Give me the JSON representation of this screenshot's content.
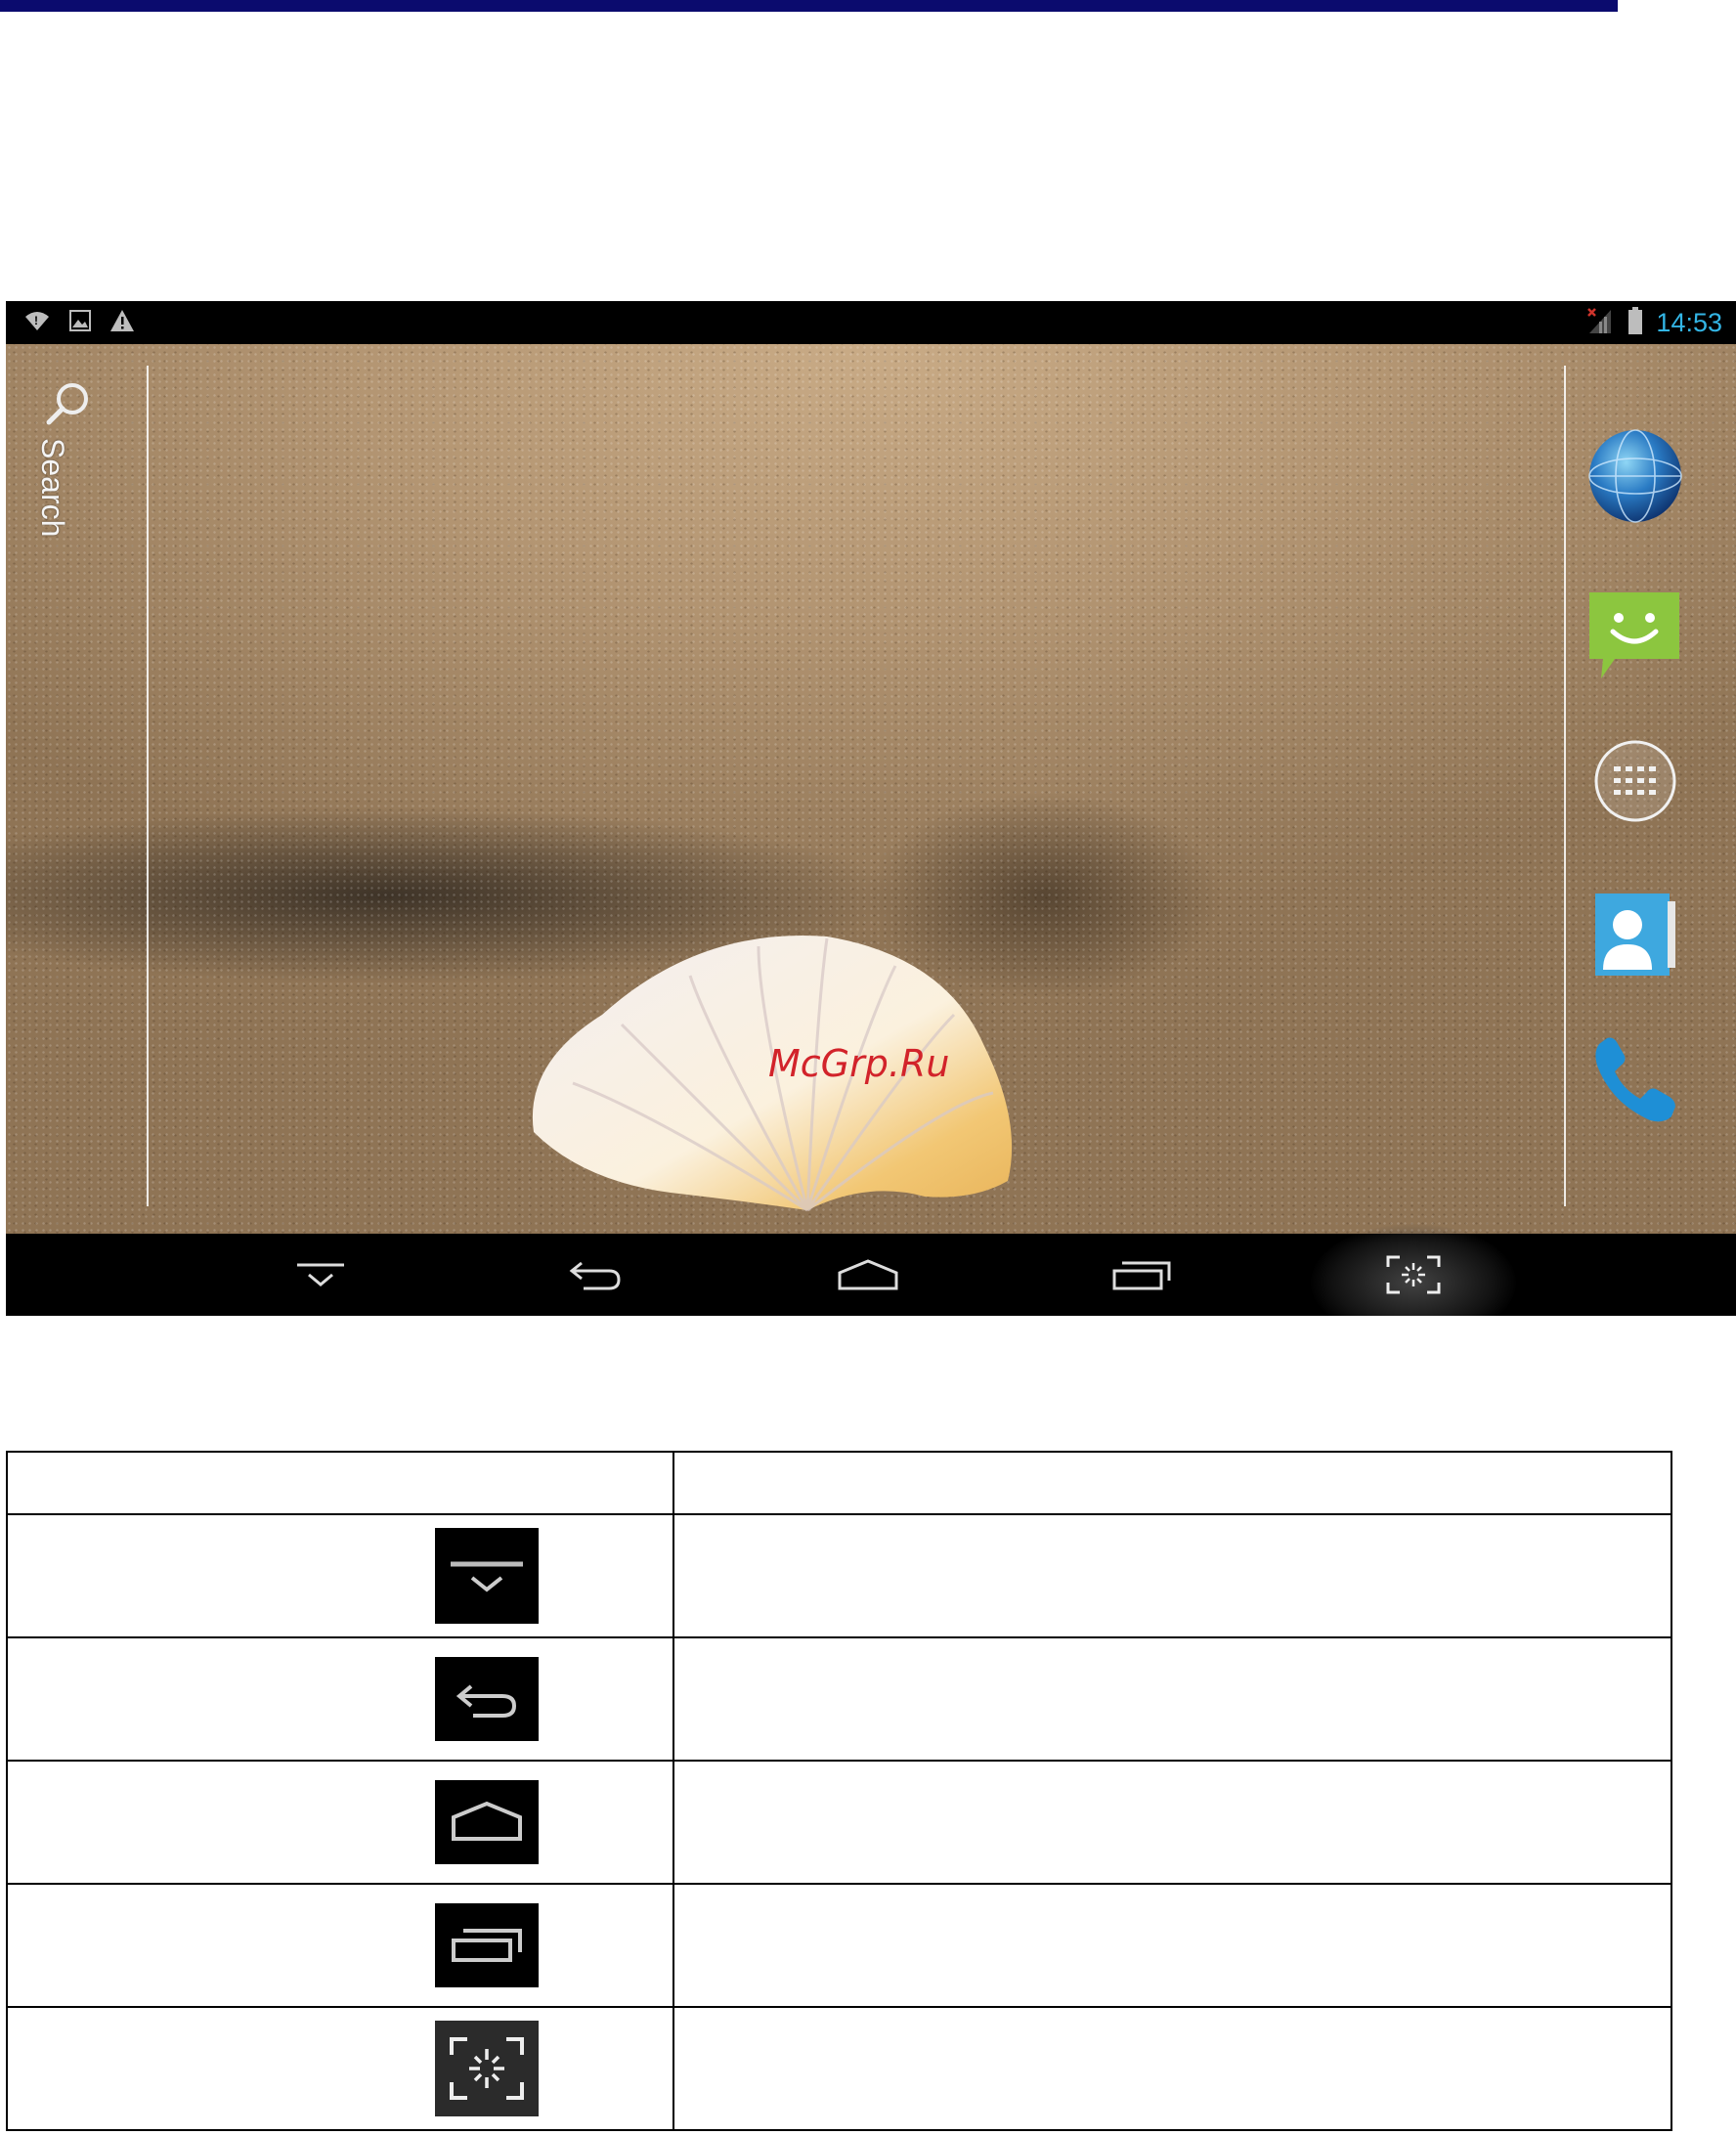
{
  "status_bar": {
    "left_icons": [
      "wifi-warning-icon",
      "image-notification-icon",
      "warning-icon"
    ],
    "right_icons": [
      "signal-icon",
      "battery-icon"
    ],
    "clock": "14:53"
  },
  "home": {
    "search_label": "Search",
    "dock_items": [
      "browser-globe-icon",
      "messaging-icon",
      "all-apps-icon",
      "contacts-icon",
      "phone-icon"
    ]
  },
  "watermark": "McGrp.Ru",
  "nav_bar": {
    "buttons": [
      "hide-bar-icon",
      "back-icon",
      "home-icon",
      "recent-apps-icon",
      "screenshot-icon"
    ]
  },
  "table": {
    "header": [
      "",
      ""
    ],
    "rows": [
      {
        "icon": "hide-bar-icon",
        "description": ""
      },
      {
        "icon": "back-icon",
        "description": ""
      },
      {
        "icon": "home-icon",
        "description": ""
      },
      {
        "icon": "recent-apps-icon",
        "description": ""
      },
      {
        "icon": "screenshot-icon",
        "description": ""
      }
    ]
  },
  "colors": {
    "top_rule": "#0b0b6e",
    "clock": "#33b5e5",
    "watermark": "#d2232a",
    "messaging": "#8cc63f",
    "phone": "#1e8fd6"
  }
}
